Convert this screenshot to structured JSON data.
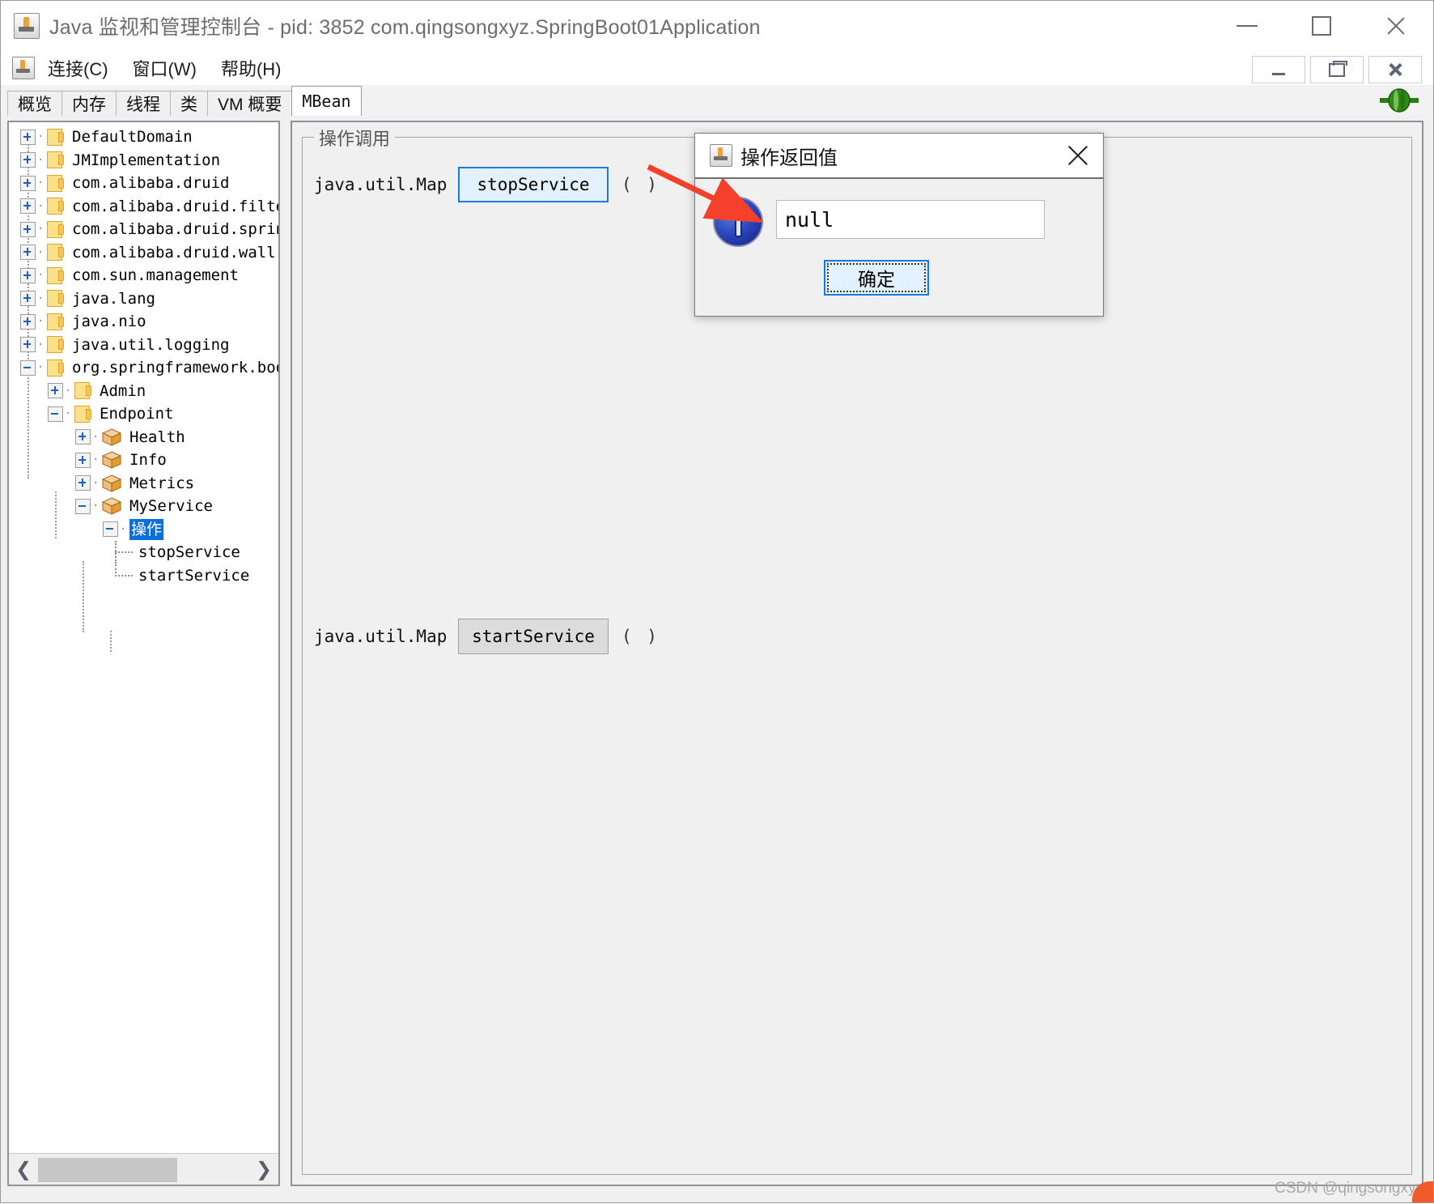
{
  "window": {
    "title": "Java 监视和管理控制台 - pid: 3852 com.qingsongxyz.SpringBoot01Application",
    "icon": "java-cup-icon",
    "minimize_label": "—",
    "maximize_label": "□",
    "close_label": "✕"
  },
  "menubar": {
    "icon": "java-cup-icon",
    "items": [
      {
        "label": "连接(C)"
      },
      {
        "label": "窗口(W)"
      },
      {
        "label": "帮助(H)"
      }
    ],
    "inner_window_buttons": [
      {
        "name": "inner-minimize",
        "label": "_"
      },
      {
        "name": "inner-restore",
        "label": "❐"
      },
      {
        "name": "inner-close",
        "label": "✕"
      }
    ]
  },
  "tabs": {
    "items": [
      {
        "label": "概览",
        "active": false
      },
      {
        "label": "内存",
        "active": false
      },
      {
        "label": "线程",
        "active": false
      },
      {
        "label": "类",
        "active": false
      },
      {
        "label": "VM 概要",
        "active": false
      },
      {
        "label": "MBean",
        "active": true
      }
    ],
    "connection_indicator": "connected-plug-icon"
  },
  "tree": {
    "nodes": [
      {
        "label": "DefaultDomain",
        "icon": "folder-icon",
        "toggle": "plus",
        "depth": 0
      },
      {
        "label": "JMImplementation",
        "icon": "folder-icon",
        "toggle": "plus",
        "depth": 0
      },
      {
        "label": "com.alibaba.druid",
        "icon": "folder-icon",
        "toggle": "plus",
        "depth": 0
      },
      {
        "label": "com.alibaba.druid.filter.",
        "icon": "folder-icon",
        "toggle": "plus",
        "depth": 0
      },
      {
        "label": "com.alibaba.druid.spring.",
        "icon": "folder-icon",
        "toggle": "plus",
        "depth": 0
      },
      {
        "label": "com.alibaba.druid.wall",
        "icon": "folder-icon",
        "toggle": "plus",
        "depth": 0
      },
      {
        "label": "com.sun.management",
        "icon": "folder-icon",
        "toggle": "plus",
        "depth": 0
      },
      {
        "label": "java.lang",
        "icon": "folder-icon",
        "toggle": "plus",
        "depth": 0
      },
      {
        "label": "java.nio",
        "icon": "folder-icon",
        "toggle": "plus",
        "depth": 0
      },
      {
        "label": "java.util.logging",
        "icon": "folder-icon",
        "toggle": "plus",
        "depth": 0
      },
      {
        "label": "org.springframework.boot",
        "icon": "folder-icon",
        "toggle": "minus",
        "depth": 0
      },
      {
        "label": "Admin",
        "icon": "folder-icon",
        "toggle": "plus",
        "depth": 1
      },
      {
        "label": "Endpoint",
        "icon": "folder-icon",
        "toggle": "minus",
        "depth": 1
      },
      {
        "label": "Health",
        "icon": "mbean-icon",
        "toggle": "plus",
        "depth": 2
      },
      {
        "label": "Info",
        "icon": "mbean-icon",
        "toggle": "plus",
        "depth": 2
      },
      {
        "label": "Metrics",
        "icon": "mbean-icon",
        "toggle": "plus",
        "depth": 2
      },
      {
        "label": "MyService",
        "icon": "mbean-icon",
        "toggle": "minus",
        "depth": 2
      },
      {
        "label": "操作",
        "icon": "none",
        "toggle": "minus",
        "depth": 3,
        "selected": true
      },
      {
        "label": "stopService",
        "icon": "none",
        "toggle": "leaf",
        "depth": 4
      },
      {
        "label": "startService",
        "icon": "none",
        "toggle": "leaf",
        "depth": 4
      }
    ],
    "scrollbar": {
      "left_arrow": "❮",
      "right_arrow": "❯"
    }
  },
  "main": {
    "group_title": "操作调用",
    "operations": [
      {
        "return_type": "java.util.Map",
        "name": "stopService",
        "params": "(  )",
        "focused": true
      },
      {
        "return_type": "java.util.Map",
        "name": "startService",
        "params": "(  )",
        "focused": false
      }
    ]
  },
  "dialog": {
    "title": "操作返回值",
    "icon": "java-cup-icon",
    "close_label": "✕",
    "message_icon": "information-icon",
    "value": "null",
    "ok_label": "确定"
  },
  "annotation": {
    "arrow_color": "#f5402c",
    "arrow_name": "red-arrow-annotation"
  },
  "watermark": {
    "text": "CSDN @qingsongxyz"
  },
  "colors": {
    "accent": "#1a78d8",
    "selection": "#0a6fdd",
    "folder": "#ffe08a",
    "annotation": "#f5402c"
  }
}
